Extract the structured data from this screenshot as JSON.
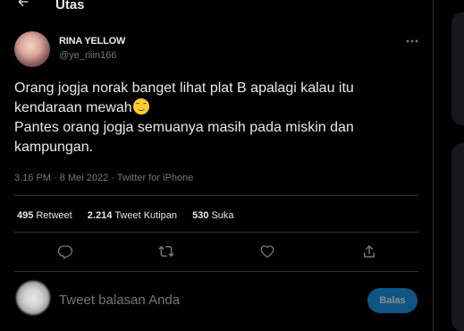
{
  "header": {
    "title": "Utas",
    "back_icon": "arrow-left-icon"
  },
  "tweet": {
    "author_name": "RINA YELLOW",
    "author_handle": "@ye_riiin166",
    "more_icon": "more-horizontal-icon",
    "text_line1": "Orang jogja norak banget lihat plat B apalagi kalau itu",
    "text_line2": "kendaraan mewah",
    "emoji": "smiling-face-emoji",
    "text_line3": "Pantes orang jogja semuanya masih pada miskin dan",
    "text_line4": "kampungan.",
    "time": "3.16 PM",
    "separator": "·",
    "date": "8 Mei 2022",
    "source": "Twitter for iPhone"
  },
  "stats": {
    "retweets_count": "495",
    "retweets_label": "Retweet",
    "quotes_count": "2.214",
    "quotes_label": "Tweet Kutipan",
    "likes_count": "530",
    "likes_label": "Suka"
  },
  "actions": {
    "reply_icon": "reply-icon",
    "retweet_icon": "retweet-icon",
    "like_icon": "heart-icon",
    "share_icon": "share-icon"
  },
  "reply": {
    "placeholder": "Tweet balasan Anda",
    "button_label": "Balas"
  },
  "colors": {
    "background": "#000000",
    "text": "#e7e9ea",
    "secondary_text": "#71767b",
    "accent": "#1d9bf0",
    "divider": "#2f3336"
  }
}
